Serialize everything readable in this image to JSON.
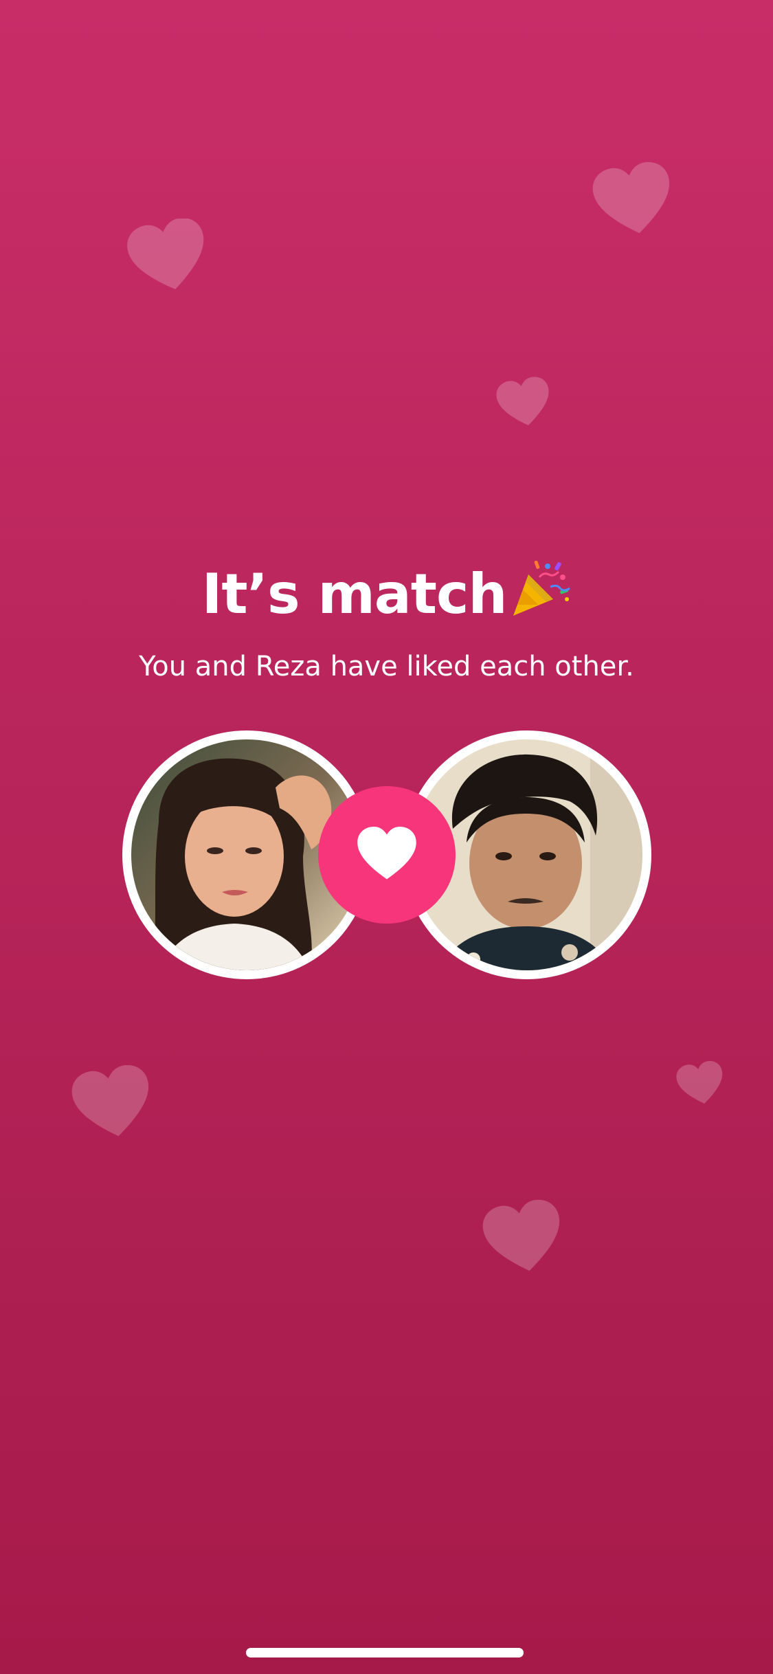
{
  "screen": {
    "title": "It’s match",
    "title_emoji": "party-popper-icon",
    "subtitle": "You and Reza have liked each other."
  },
  "avatars": {
    "left": {
      "description": "profile-photo-woman"
    },
    "right": {
      "description": "profile-photo-reza"
    }
  },
  "badge": {
    "icon": "heart-icon"
  },
  "colors": {
    "background_top": "#c92d68",
    "background_bottom": "#a61a4a",
    "badge": "#f7357a",
    "decorative_heart": "#ffffff",
    "text": "#ffffff"
  }
}
